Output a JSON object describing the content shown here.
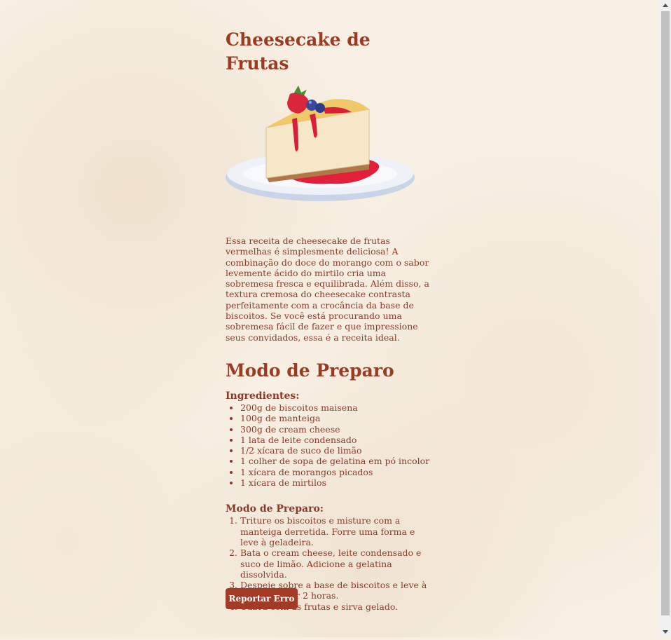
{
  "page": {
    "title": "Cheesecake de Frutas",
    "hero_image": "cheesecake-slice-with-strawberry-and-blueberries",
    "intro": "Essa receita de cheesecake de frutas vermelhas é simplesmente deliciosa! A combinação do doce do morango com o sabor levemente ácido do mirtilo cria uma sobremesa fresca e equilibrada. Além disso, a textura cremosa do cheesecake contrasta perfeitamente com a crocância da base de biscoitos. Se você está procurando uma sobremesa fácil de fazer e que impressione seus convidados, essa é a receita ideal.",
    "section_title": "Modo de Preparo",
    "ingredients_title": "Ingredientes:",
    "ingredients": [
      "200g de biscoitos maisena",
      "100g de manteiga",
      "300g de cream cheese",
      "1 lata de leite condensado",
      "1/2 xícara de suco de limão",
      "1 colher de sopa de gelatina em pó incolor",
      "1 xícara de morangos picados",
      "1 xícara de mirtilos"
    ],
    "steps_title": "Modo de Preparo:",
    "steps": [
      "Triture os biscoitos e misture com a manteiga derretida. Forre uma forma e leve à geladeira.",
      "Bata o cream cheese, leite condensado e suco de limão. Adicione a gelatina dissolvida.",
      "Despeje sobre a base de biscoitos e leve à geladeira por 2 horas.",
      "Cubra com as frutas e sirva gelado."
    ],
    "report_button": "Reportar Erro"
  },
  "colors": {
    "accent": "#9a3b24",
    "text": "#8a3a2a",
    "button": "#a33a26",
    "background": "#f8f0e4"
  },
  "icons": {
    "scroll_up": "triangle-up-icon",
    "scroll_down": "triangle-down-icon"
  }
}
